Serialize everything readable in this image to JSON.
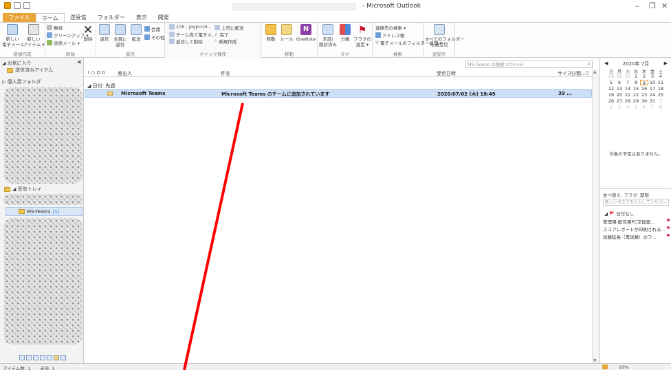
{
  "window": {
    "title": "- Microsoft Outlook",
    "controls": {
      "minimize": "–",
      "restore": "❐",
      "close": "✕"
    }
  },
  "tabs": [
    {
      "label": "ファイル"
    },
    {
      "label": "ホーム"
    },
    {
      "label": "送受信"
    },
    {
      "label": "フォルダー"
    },
    {
      "label": "表示"
    },
    {
      "label": "開発"
    }
  ],
  "ribbon": {
    "new": {
      "email": "新しい\n電子メール",
      "items": "新しい\nアイテム ▾",
      "group": "新規作成"
    },
    "delete": {
      "ignore": "無視",
      "cleanup": "クリーンアップ ▾",
      "junk": "迷惑メール ▾",
      "delete": "削除",
      "group": "削除"
    },
    "respond": {
      "reply": "返信",
      "reply_all": "全員に\n返信",
      "forward": "転送",
      "meeting": "会議",
      "more": "その他 ▾",
      "group": "返信"
    },
    "quick": {
      "s1": "10S - joypccol...",
      "s2": "チーム宛て電子メ...",
      "s3": "返信して削除",
      "s4": "上司に転送",
      "s5": "完了",
      "s6": "新規作成",
      "group": "クイック操作"
    },
    "move": {
      "move": "移動",
      "rules": "ルール",
      "onenote": "OneNote",
      "group": "移動"
    },
    "tags": {
      "unread": "未読/\n開封済み",
      "categorize": "分類",
      "followup": "フラグの\n設定 ▾",
      "group": "タグ"
    },
    "find": {
      "people": "連絡先の検索 ▾",
      "address": "アドレス帳",
      "filter": "電子メールのフィルター処理 ▾",
      "group": "検索"
    },
    "sendrecv": {
      "all": "すべてのフォルダー\nを送受信",
      "group": "送受信"
    },
    "colors": {
      "file_tab": "#e9a43a",
      "flag": "#c8102e"
    }
  },
  "left": {
    "favorites": "◢ お気に入り",
    "sent": "送信済みアイテム",
    "personal": "▷ 個人用フォルダ",
    "inbox": "◢ 受信トレイ",
    "msteams": "MS-Teams",
    "msteams_count": "(1)"
  },
  "list": {
    "search_placeholder": "MS-Teams の検索 (Ctrl+E)",
    "columns": {
      "icons": "! ☖ D 0",
      "from": "差出人",
      "subject": "件名",
      "received": "受信日時",
      "size": "サイズ",
      "category": "分類...▽"
    },
    "group": "◢ 日付: 先週",
    "rows": [
      {
        "from": "Microsoft Teams",
        "subject": "Microsoft Teams のチームに追加されています",
        "received": "2020/07/02 (木) 18:49",
        "size": "39 ..."
      }
    ]
  },
  "todo": {
    "month": "2020年 7月",
    "prev": "◀",
    "next": "▶",
    "dow": [
      "日",
      "月",
      "火",
      "水",
      "木",
      "金",
      "土"
    ],
    "days": [
      {
        "d": "28",
        "o": true
      },
      {
        "d": "29",
        "o": true
      },
      {
        "d": "30",
        "o": true
      },
      {
        "d": "1"
      },
      {
        "d": "2"
      },
      {
        "d": "3"
      },
      {
        "d": "4"
      },
      {
        "d": "5"
      },
      {
        "d": "6"
      },
      {
        "d": "7"
      },
      {
        "d": "8"
      },
      {
        "d": "9",
        "t": true
      },
      {
        "d": "10"
      },
      {
        "d": "11"
      },
      {
        "d": "12"
      },
      {
        "d": "13"
      },
      {
        "d": "14"
      },
      {
        "d": "15"
      },
      {
        "d": "16"
      },
      {
        "d": "17"
      },
      {
        "d": "18"
      },
      {
        "d": "19"
      },
      {
        "d": "20"
      },
      {
        "d": "21"
      },
      {
        "d": "22"
      },
      {
        "d": "23"
      },
      {
        "d": "24"
      },
      {
        "d": "25"
      },
      {
        "d": "26"
      },
      {
        "d": "27"
      },
      {
        "d": "28"
      },
      {
        "d": "29"
      },
      {
        "d": "30"
      },
      {
        "d": "31"
      },
      {
        "d": "1",
        "o": true
      },
      {
        "d": "2",
        "o": true
      },
      {
        "d": "3",
        "o": true
      },
      {
        "d": "4",
        "o": true
      },
      {
        "d": "5",
        "o": true
      },
      {
        "d": "6",
        "o": true
      },
      {
        "d": "7",
        "o": true
      },
      {
        "d": "8",
        "o": true
      }
    ],
    "no_appointments": "今後の予定はありません。",
    "arrange": "並べ替え: フラグ: 期限",
    "new_task_placeholder": "新しいタスクを入力してください",
    "flag_group": "◢ 🚩 日付なし",
    "tasks": [
      "管理用-配信用PC交換案...",
      "スコアレポートが印刷される...",
      "試験延長（再試験）のフ..."
    ]
  },
  "status": {
    "items": "アイテム数: 1",
    "unread": "未読: 1",
    "zoom": "10%"
  }
}
